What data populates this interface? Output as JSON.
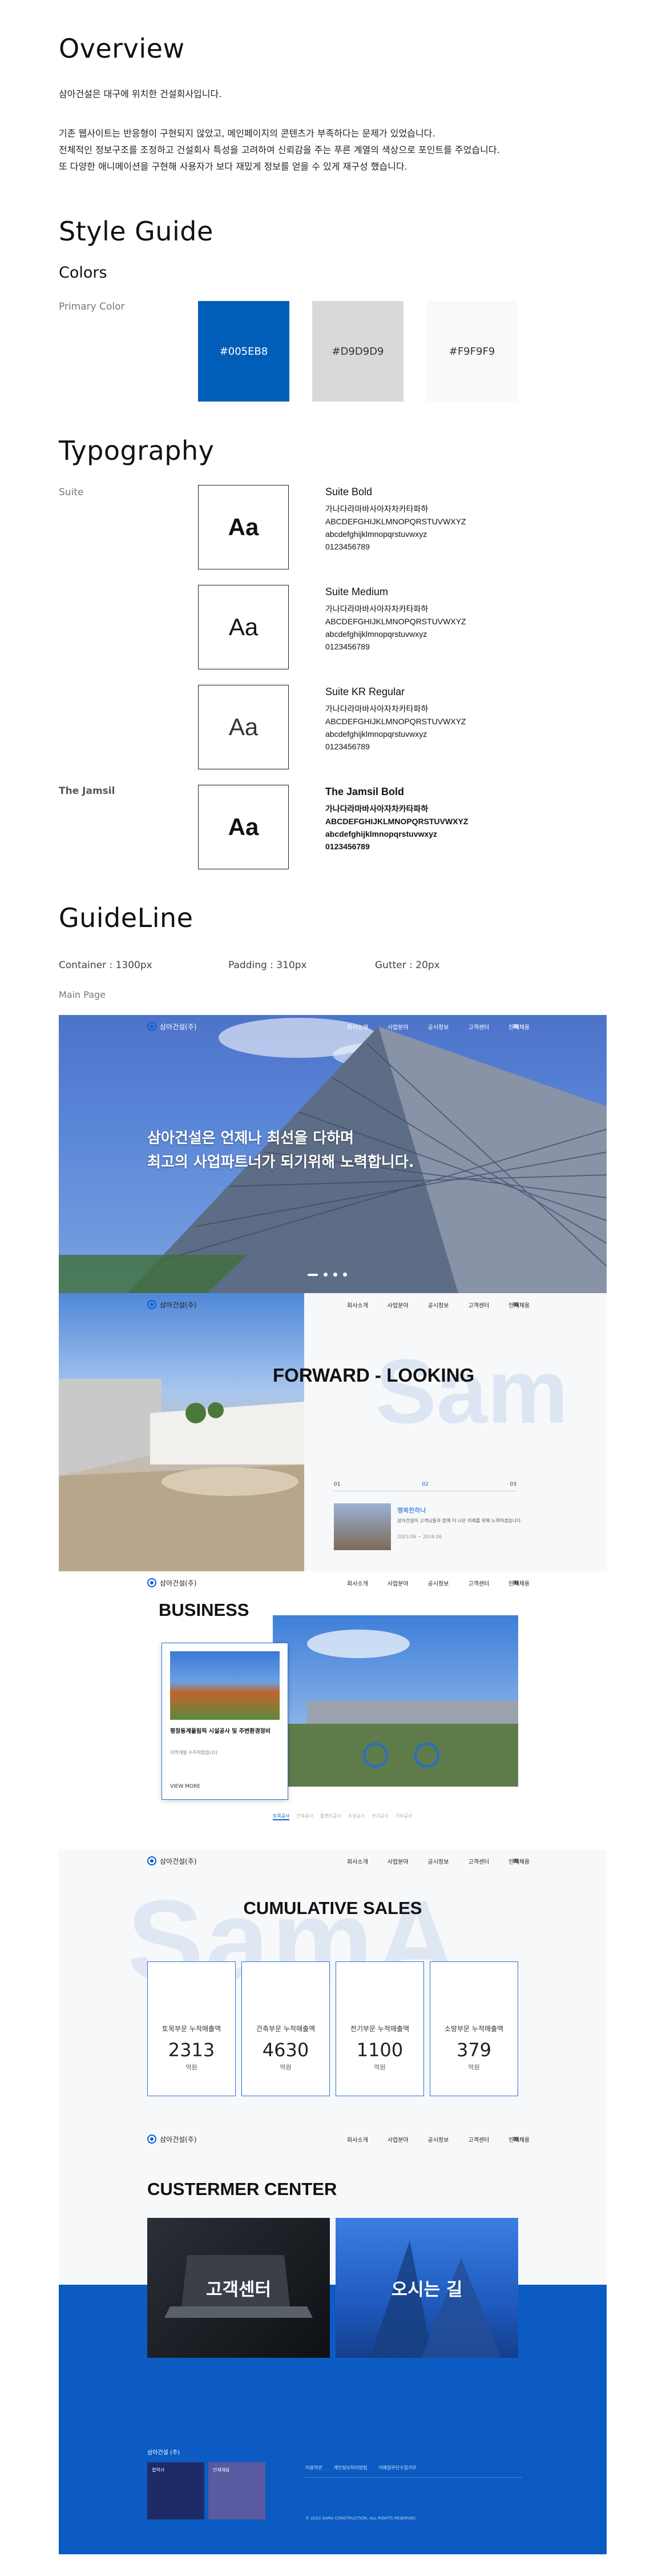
{
  "overview": {
    "title": "Overview",
    "intro": "삼아건설은 대구에 위치한 건설회사입니다.",
    "p1": "기존 웹사이트는 반응형이 구현되지 않았고, 메인페이지의 콘텐츠가 부족하다는 문제가 있었습니다.",
    "p2": "전체적인 정보구조를 조정하고 건설회사 특성을 고려하여 신뢰감을 주는 푸른 계열의 색상으로 포인트를 주었습니다.",
    "p3": "또 다양한 애니메이션을 구현해 사용자가 보다 재밌게 정보를 얻을 수 있게 재구성 했습니다."
  },
  "style_guide": {
    "title": "Style Guide",
    "colors_title": "Colors",
    "primary_label": "Primary Color",
    "swatches": [
      {
        "hex": "#005EB8",
        "text_color": "#ffffff"
      },
      {
        "hex": "#D9D9D9",
        "text_color": "#333333"
      },
      {
        "hex": "#F9F9F9",
        "text_color": "#333333"
      }
    ]
  },
  "typography": {
    "title": "Typography",
    "font1": "Suite",
    "font2": "The Jamsil",
    "aa": "Aa",
    "samples": [
      {
        "name": "Suite Bold",
        "korean": "가나다라마바사아자차카타파하",
        "upper": "ABCDEFGHIJKLMNOPQRSTUVWXYZ",
        "lower": "abcdefghijklmnopqrstuvwxyz",
        "digits": "0123456789"
      },
      {
        "name": "Suite Medium",
        "korean": "가나다라마바사아자차카타파하",
        "upper": "ABCDEFGHIJKLMNOPQRSTUVWXYZ",
        "lower": "abcdefghijklmnopqrstuvwxyz",
        "digits": "0123456789"
      },
      {
        "name": "Suite KR Regular",
        "korean": "가나다라마바사아자차카타파하",
        "upper": "ABCDEFGHIJKLMNOPQRSTUVWXYZ",
        "lower": "abcdefghijklmnopqrstuvwxyz",
        "digits": "0123456789"
      },
      {
        "name": "The Jamsil Bold",
        "korean": "가나다라마바사아자차카타파하",
        "upper": "ABCDEFGHIJKLMNOPQRSTUVWXYZ",
        "lower": "abcdefghijklmnopqrstuvwxyz",
        "digits": "0123456789"
      }
    ]
  },
  "guideline": {
    "title": "GuideLine",
    "container": "Container : 1300px",
    "padding": "Padding : 310px",
    "gutter": "Gutter : 20px",
    "main_page": "Main Page"
  },
  "mock": {
    "logo": "삼아건설(주)",
    "menu": [
      "회사소개",
      "사업분야",
      "공시정보",
      "고객센터",
      "인재채용"
    ],
    "burger": "≡",
    "hero_line1": "삼아건설은 언제나 최선을 다하며",
    "hero_line2": "최고의 사업파트너가 되기위해 노력합니다.",
    "forward_title": "FORWARD - LOOKING",
    "forward_bg": "Sam",
    "forward_tabs": [
      "01",
      "02",
      "03"
    ],
    "forward_card_title": "행복한하나",
    "forward_card_desc": "삼아건설이 고객님들과 함께 더 나은 미래를 위해 노력하겠습니다.",
    "forward_card_date": "2023.06 ~ 2024.06",
    "business_title": "BUSINESS",
    "business_card_title": "평창동계올림픽 시설공사 및 주변환경정비",
    "business_card_sub": "지역개발 수주하였습니다",
    "business_card_link": "VIEW MORE",
    "business_tabs": [
      "토목공사",
      "건축공사",
      "플랜트공사",
      "조경공사",
      "전기공사",
      "기타공사"
    ],
    "sales_title": "CUMULATIVE SALES",
    "sales_bg": "SamA",
    "stats": [
      {
        "title": "토목부문 누적매출액",
        "value": "2313",
        "unit": "억원"
      },
      {
        "title": "건축부문 누적매출액",
        "value": "4630",
        "unit": "억원"
      },
      {
        "title": "전기부문 누적매출액",
        "value": "1100",
        "unit": "억원"
      },
      {
        "title": "소방부문 누적매출액",
        "value": "379",
        "unit": "억원"
      }
    ],
    "cs_title": "CUSTERMER CENTER",
    "cs_card1": "고객센터",
    "cs_card2": "오시는 길",
    "footer_logo": "삼아건설 (주)",
    "footer_box1": "협력사",
    "footer_box2": "인재채용",
    "footer_links": [
      "이용약관",
      "개인정보처리방침",
      "이메일무단수집거부"
    ],
    "footer_copy": "© 2023 SAMA CONSTRUCTION. ALL RIGHTS RESERVED."
  }
}
